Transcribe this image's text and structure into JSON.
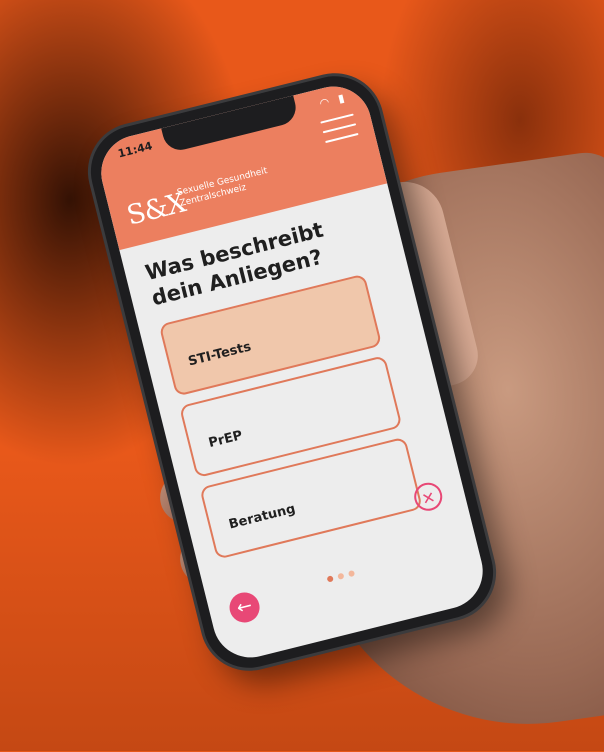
{
  "status_bar": {
    "time": "11:44",
    "icons": "wifi-icon battery-icon"
  },
  "header": {
    "logo": "S&X",
    "org_line1": "Sexuelle Gesundheit",
    "org_line2": "Zentralschweiz",
    "menu_icon": "hamburger-menu-icon",
    "color": "#ec7f5f"
  },
  "question": "Was beschreibt dein Anliegen?",
  "options": [
    {
      "label": "STI-Tests",
      "selected": true
    },
    {
      "label": "PrEP",
      "selected": false
    },
    {
      "label": "Beratung",
      "selected": false
    }
  ],
  "pagination": {
    "total": 3,
    "active": 1
  },
  "buttons": {
    "back_icon": "arrow-left-icon",
    "back_glyph": "←",
    "close_icon": "close-icon",
    "close_glyph": "✕"
  },
  "colors": {
    "background": "#e8581a",
    "accent": "#e0795a",
    "selected_fill": "#f0c7ab",
    "pink": "#e84876"
  }
}
